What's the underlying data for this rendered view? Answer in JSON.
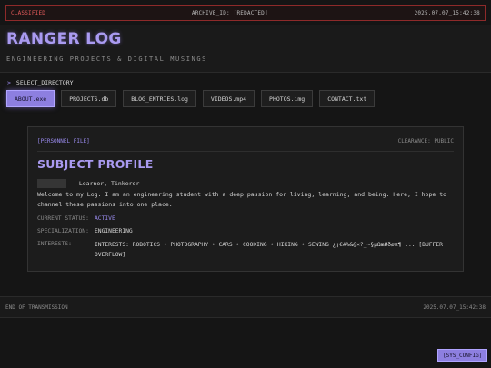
{
  "topbar": {
    "classified": "CLASSIFIED",
    "archive_id": "ARCHIVE_ID: [REDACTED]",
    "timestamp": "2025.07.07_15:42:38"
  },
  "header": {
    "title": "RANGER LOG",
    "subtitle": "ENGINEERING PROJECTS & DIGITAL MUSINGS"
  },
  "directory": {
    "caret": ">",
    "prompt": "SELECT_DIRECTORY:",
    "items": [
      {
        "label": "ABOUT.exe",
        "active": true
      },
      {
        "label": "PROJECTS.db",
        "active": false
      },
      {
        "label": "BLOG_ENTRIES.log",
        "active": false
      },
      {
        "label": "VIDEOS.mp4",
        "active": false
      },
      {
        "label": "PHOTOS.img",
        "active": false
      },
      {
        "label": "CONTACT.txt",
        "active": false
      }
    ]
  },
  "profile": {
    "file_tag": "[PERSONNEL FILE]",
    "clearance": "CLEARANCE: PUBLIC",
    "title": "SUBJECT PROFILE",
    "roles": "- Learner, Tinkerer",
    "bio": "Welcome to my Log. I am an engineering student with a deep passion for living, learning, and being. Here, I hope to channel these passions into one place.",
    "status_label": "CURRENT STATUS:",
    "status_value": "ACTIVE",
    "specialization_label": "SPECIALIZATION:",
    "specialization_value": "ENGINEERING",
    "interests_label": "INTERESTS:",
    "interests_value": "INTERESTS: ROBOTICS • PHOTOGRAPHY • CARS • COOKING • HIKING • SEWING ¿¡€#%&@×?_~§µΩæØðøπ¶ ... [BUFFER OVERFLOW]"
  },
  "footer": {
    "left": "END OF TRANSMISSION",
    "right": "2025.07.07_15:42:38"
  },
  "sys_config": "[SYS_CONFIG]",
  "colors": {
    "accent": "#9b8cf0",
    "alert": "#e35a5a",
    "background": "#151515"
  }
}
